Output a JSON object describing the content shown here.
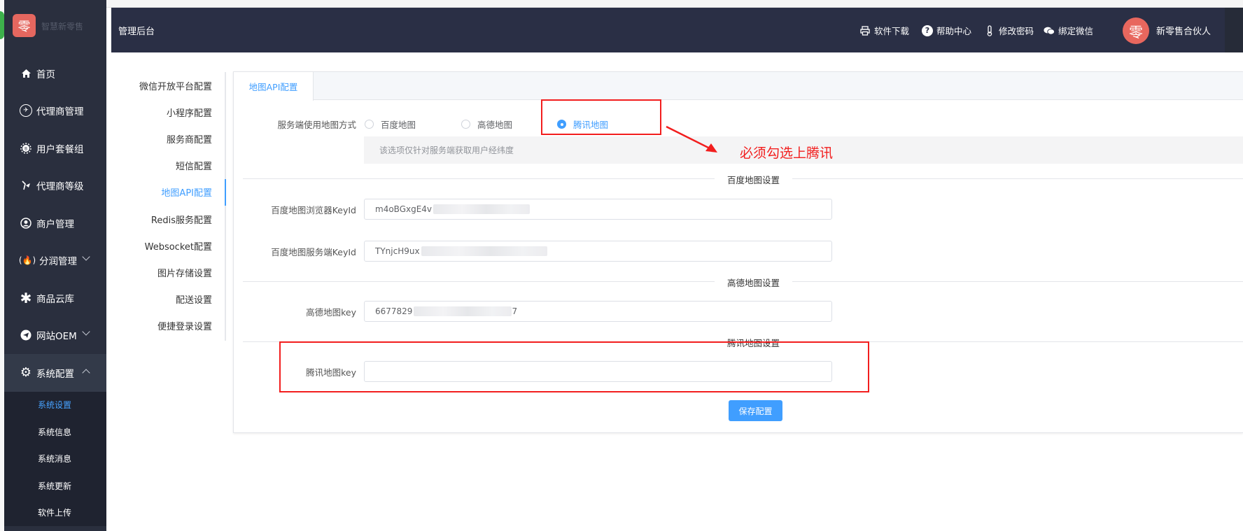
{
  "header": {
    "title": "管理后台",
    "links": [
      {
        "label": "软件下载",
        "icon": "printer-icon"
      },
      {
        "label": "帮助中心",
        "icon": "help-icon"
      },
      {
        "label": "修改密码",
        "icon": "thermometer-icon"
      },
      {
        "label": "绑定微信",
        "icon": "wechat-icon"
      }
    ],
    "user_name": "新零售合伙人",
    "avatar_glyph": "零"
  },
  "brand": {
    "logo_glyph": "零",
    "name": "智慧新零售"
  },
  "sidebar": {
    "items": [
      {
        "label": "首页",
        "icon": "home-icon"
      },
      {
        "label": "代理商管理",
        "icon": "agent-icon"
      },
      {
        "label": "用户套餐组",
        "icon": "package-icon"
      },
      {
        "label": "代理商等级",
        "icon": "level-icon"
      },
      {
        "label": "商户管理",
        "icon": "merchant-icon"
      },
      {
        "label": "分润管理",
        "icon": "fire-icon"
      },
      {
        "label": "商品云库",
        "icon": "asterisk-icon"
      },
      {
        "label": "网站OEM",
        "icon": "send-icon"
      },
      {
        "label": "系统配置",
        "icon": "gear-icon"
      }
    ],
    "sub_items": [
      {
        "label": "系统设置"
      },
      {
        "label": "系统信息"
      },
      {
        "label": "系统消息"
      },
      {
        "label": "系统更新"
      },
      {
        "label": "软件上传"
      }
    ]
  },
  "config_menu": {
    "items": [
      {
        "label": "微信开放平台配置"
      },
      {
        "label": "小程序配置"
      },
      {
        "label": "服务商配置"
      },
      {
        "label": "短信配置"
      },
      {
        "label": "地图API配置"
      },
      {
        "label": "Redis服务配置"
      },
      {
        "label": "Websocket配置"
      },
      {
        "label": "图片存储设置"
      },
      {
        "label": "配送设置"
      },
      {
        "label": "便捷登录设置"
      }
    ],
    "active": "地图API配置"
  },
  "panel": {
    "tab": "地图API配置",
    "map_mode": {
      "label": "服务端使用地图方式",
      "options": [
        "百度地图",
        "高德地图",
        "腾讯地图"
      ],
      "selected": "腾讯地图",
      "tip": "该选项仅针对服务端获取用户经纬度"
    },
    "baidu": {
      "section": "百度地图设置",
      "browser_key_label": "百度地图浏览器KeyId",
      "browser_key_value": "m4oBGxgE4v",
      "server_key_label": "百度地图服务端KeyId",
      "server_key_value": "TYnjcH9ux"
    },
    "gaode": {
      "section": "高德地图设置",
      "key_label": "高德地图key",
      "key_value_start": "6677829",
      "key_value_end": "7"
    },
    "tencent": {
      "section": "腾讯地图设置",
      "key_label": "腾讯地图key",
      "key_value": ""
    },
    "save_label": "保存配置"
  },
  "annotation": {
    "text": "必须勾选上腾讯",
    "color": "#f21e1e"
  },
  "colors": {
    "accent": "#409eff",
    "sidebar_bg": "#2a2f3e",
    "header_bg": "#2a2f45"
  }
}
